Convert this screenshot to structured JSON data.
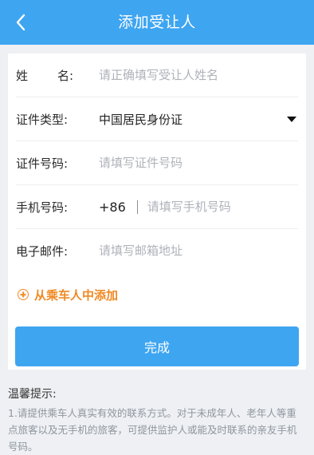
{
  "header": {
    "title": "添加受让人",
    "back_icon": "chevron-left-icon",
    "background": "#3ea5f1"
  },
  "form": {
    "name": {
      "label_chars": [
        "姓",
        "名:"
      ],
      "placeholder": "请正确填写受让人姓名"
    },
    "id_type": {
      "label": "证件类型:",
      "value": "中国居民身份证"
    },
    "id_number": {
      "label": "证件号码:",
      "placeholder": "请填写证件号码"
    },
    "phone": {
      "label": "手机号码:",
      "country_code": "+86",
      "placeholder": "请填写手机号码"
    },
    "email": {
      "label": "电子邮件:",
      "placeholder": "请填写邮箱地址"
    }
  },
  "add_from_passengers": {
    "label": "从乘车人中添加",
    "color": "#f08a24"
  },
  "complete_button": {
    "label": "完成"
  },
  "tips": {
    "title": "温馨提示:",
    "text": "1.请提供乘车人真实有效的联系方式。对于未成年人、老年人等重点旅客以及无手机的旅客，可提供监护人或能及时联系的亲友手机号码。"
  }
}
